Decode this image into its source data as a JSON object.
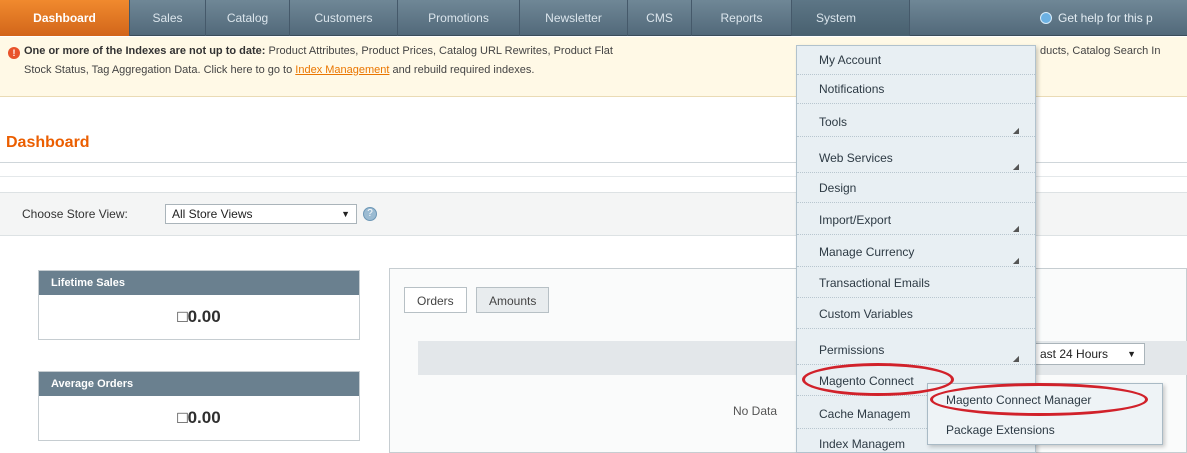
{
  "nav": {
    "items": [
      "Dashboard",
      "Sales",
      "Catalog",
      "Customers",
      "Promotions",
      "Newsletter",
      "CMS",
      "Reports",
      "System"
    ],
    "help_text": "Get help for this p"
  },
  "notice": {
    "bold": "One or more of the Indexes are not up to date:",
    "line1_rest": " Product Attributes, Product Prices, Catalog URL Rewrites, Product Flat",
    "line1_tail": "ducts, Catalog Search In",
    "line2_start": "Stock Status, Tag Aggregation Data. Click here to go to ",
    "line2_link": "Index Management",
    "line2_end": " and rebuild required indexes."
  },
  "page_title": "Dashboard",
  "store": {
    "label": "Choose Store View:",
    "selected": "All Store Views",
    "help_glyph": "?"
  },
  "stats": [
    {
      "label": "Lifetime Sales",
      "value": "□0.00"
    },
    {
      "label": "Average Orders",
      "value": "□0.00"
    }
  ],
  "tabs": [
    "Orders",
    "Amounts"
  ],
  "range_select": "ast 24 Hours",
  "no_data": "No Data",
  "system_menu": {
    "items": [
      "My Account",
      "Notifications",
      "Tools",
      "Web Services",
      "Design",
      "Import/Export",
      "Manage Currency",
      "Transactional Emails",
      "Custom Variables",
      "Permissions",
      "Magento Connect",
      "Cache Managem",
      "Index Managem"
    ],
    "submenu": [
      "Magento Connect Manager",
      "Package Extensions"
    ]
  }
}
